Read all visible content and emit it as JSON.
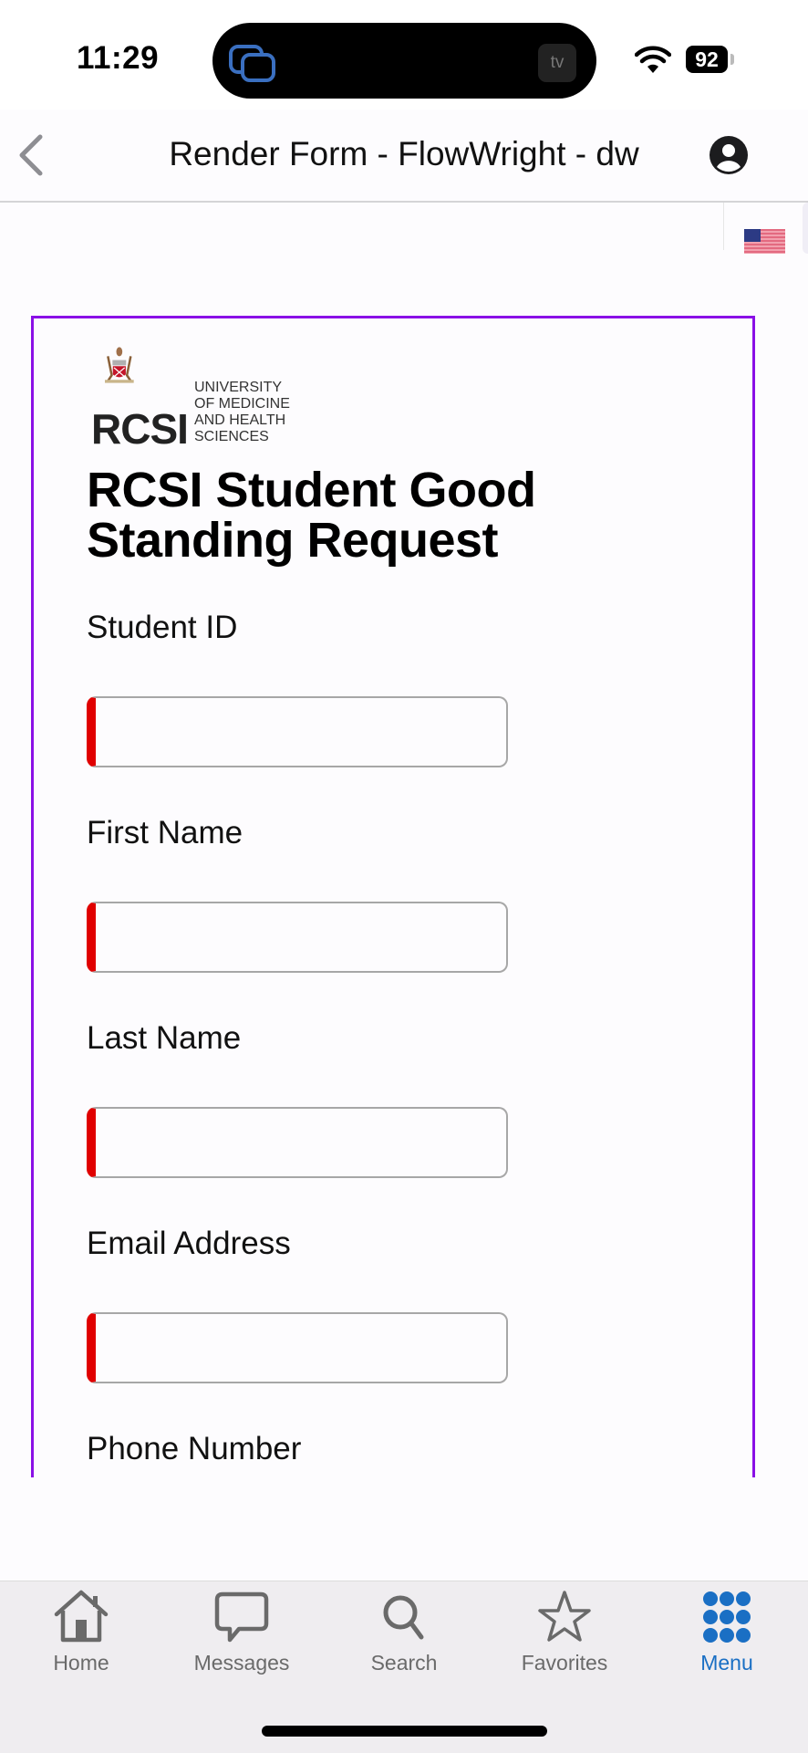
{
  "status_bar": {
    "time": "11:29",
    "battery_level": "92",
    "live_activity_badge": "tv",
    "icons": [
      "screen-mirroring-icon",
      "apple-tv-icon",
      "wifi-icon",
      "battery-icon"
    ]
  },
  "nav": {
    "title": "Render Form - FlowWright - dw",
    "back_icon": "chevron-left-icon",
    "profile_icon": "person-circle-icon"
  },
  "web": {
    "language_flag": "us-flag-icon"
  },
  "form": {
    "logo": {
      "wordmark": "RCSI",
      "subtitle_lines": [
        "UNIVERSITY",
        "OF MEDICINE",
        "AND HEALTH",
        "SCIENCES"
      ]
    },
    "title": "RCSI Student Good Standing Request",
    "fields": [
      {
        "label": "Student ID",
        "value": "",
        "required": true
      },
      {
        "label": "First Name",
        "value": "",
        "required": true
      },
      {
        "label": "Last Name",
        "value": "",
        "required": true
      },
      {
        "label": "Email Address",
        "value": "",
        "required": true
      },
      {
        "label": "Phone Number"
      }
    ],
    "colors": {
      "frame": "#8a10e6",
      "required_marker": "#e00000"
    }
  },
  "tab_bar": {
    "active": "Menu",
    "active_color": "#1a6fc4",
    "items": [
      {
        "label": "Home",
        "icon": "house-icon"
      },
      {
        "label": "Messages",
        "icon": "message-bubble-icon"
      },
      {
        "label": "Search",
        "icon": "magnifier-icon"
      },
      {
        "label": "Favorites",
        "icon": "star-icon"
      },
      {
        "label": "Menu",
        "icon": "grid-dots-icon"
      }
    ]
  }
}
